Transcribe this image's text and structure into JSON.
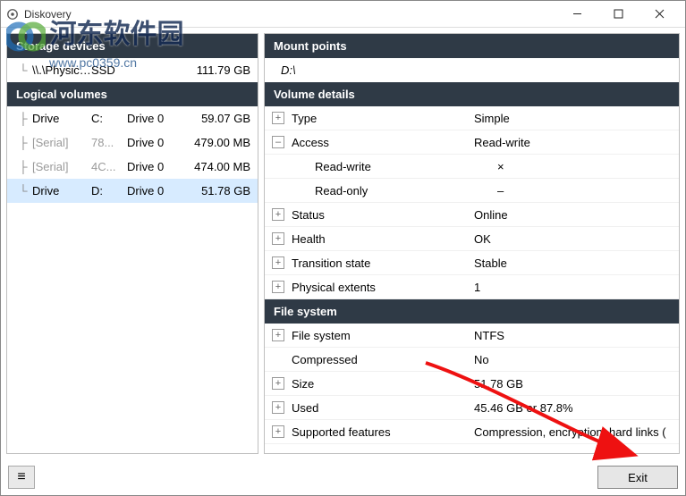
{
  "window": {
    "title": "Diskovery"
  },
  "winControls": {
    "min": "–",
    "max": "☐",
    "close": "✕"
  },
  "left": {
    "storageHeader": "Storage devices",
    "storageRow": {
      "name": "\\\\.\\Physical...",
      "type": "SSD",
      "size": "111.79 GB"
    },
    "volumesHeader": "Logical volumes",
    "volumes": [
      {
        "kind": "Drive",
        "k2": "C:",
        "dev": "Drive 0",
        "size": "59.07 GB",
        "muted": false,
        "sel": false
      },
      {
        "kind": "[Serial]",
        "k2": "78...",
        "dev": "Drive 0",
        "size": "479.00 MB",
        "muted": true,
        "sel": false
      },
      {
        "kind": "[Serial]",
        "k2": "4C...",
        "dev": "Drive 0",
        "size": "474.00 MB",
        "muted": true,
        "sel": false
      },
      {
        "kind": "Drive",
        "k2": "D:",
        "dev": "Drive 0",
        "size": "51.78 GB",
        "muted": false,
        "sel": true
      }
    ]
  },
  "right": {
    "mountHeader": "Mount points",
    "mountValue": "D:\\",
    "volDetailsHeader": "Volume details",
    "details": [
      {
        "exp": "+",
        "indent": 0,
        "label": "Type",
        "value": "Simple"
      },
      {
        "exp": "–",
        "indent": 0,
        "label": "Access",
        "value": "Read-write"
      },
      {
        "exp": "",
        "indent": 1,
        "label": "Read-write",
        "value": "×"
      },
      {
        "exp": "",
        "indent": 1,
        "label": "Read-only",
        "value": "–"
      },
      {
        "exp": "+",
        "indent": 0,
        "label": "Status",
        "value": "Online"
      },
      {
        "exp": "+",
        "indent": 0,
        "label": "Health",
        "value": "OK"
      },
      {
        "exp": "+",
        "indent": 0,
        "label": "Transition state",
        "value": "Stable"
      },
      {
        "exp": "+",
        "indent": 0,
        "label": "Physical extents",
        "value": "1"
      }
    ],
    "fsHeader": "File system",
    "fsDetails": [
      {
        "exp": "+",
        "indent": 0,
        "label": "File system",
        "value": "NTFS"
      },
      {
        "exp": "",
        "indent": 0,
        "label": "Compressed",
        "value": "No"
      },
      {
        "exp": "+",
        "indent": 0,
        "label": "Size",
        "value": "51.78 GB"
      },
      {
        "exp": "+",
        "indent": 0,
        "label": "Used",
        "value": "45.46 GB  or  87.8%"
      },
      {
        "exp": "+",
        "indent": 0,
        "label": "Supported features",
        "value": "Compression, encryption, hard links ("
      }
    ]
  },
  "bottom": {
    "menu": "≡",
    "exit": "Exit"
  },
  "watermark": {
    "text": "河东软件园",
    "sub": "www.pc0359.cn"
  }
}
